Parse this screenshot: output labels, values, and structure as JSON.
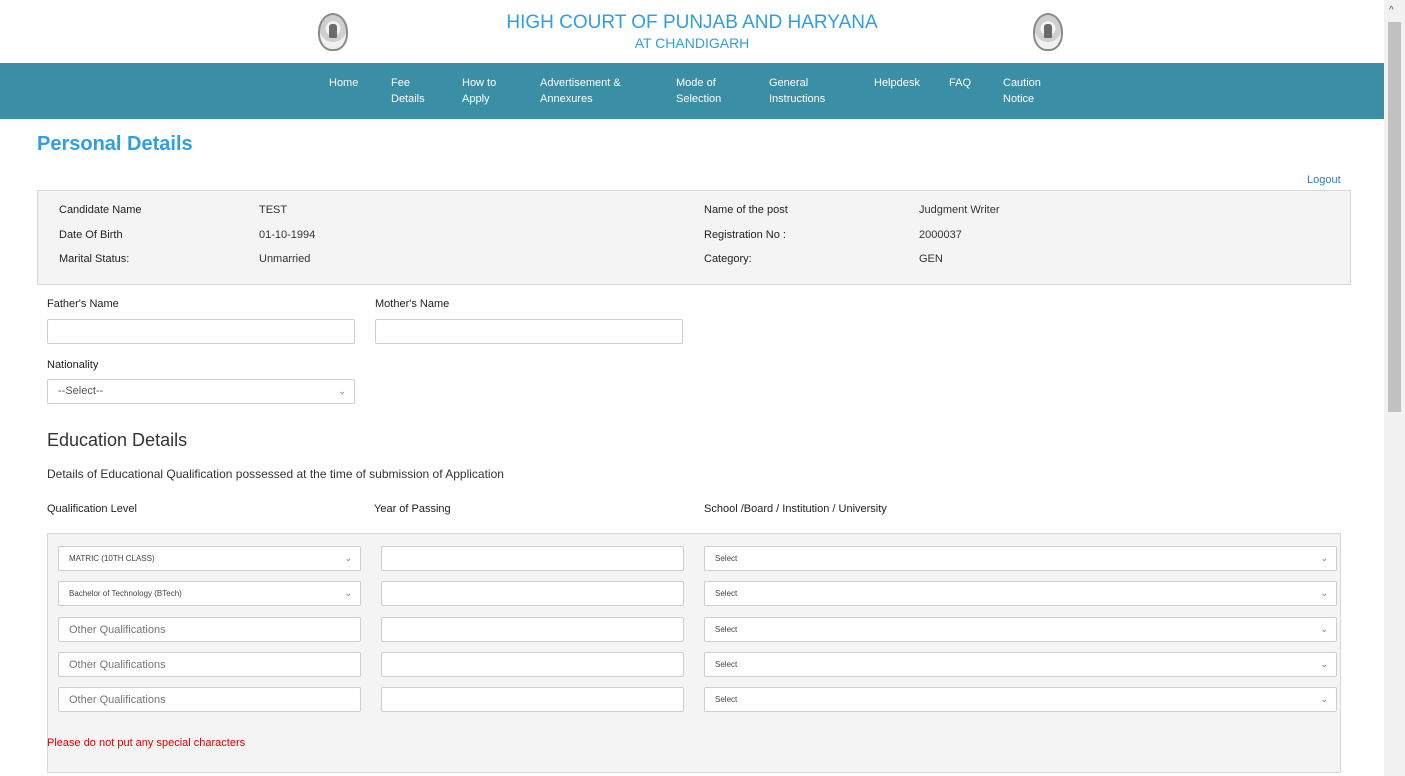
{
  "header": {
    "title": "HIGH COURT OF PUNJAB AND HARYANA",
    "subtitle": "AT CHANDIGARH"
  },
  "nav": [
    "Home",
    "Fee\nDetails",
    "How to\nApply",
    "Advertisement &\nAnnexures",
    "Mode of\nSelection",
    "General\nInstructions",
    "Helpdesk",
    "FAQ",
    "Caution\nNotice"
  ],
  "page": {
    "title": "Personal Details",
    "logout": "Logout"
  },
  "candidate": {
    "name_label": "Candidate Name",
    "name": "TEST",
    "dob_label": "Date Of Birth",
    "dob": "01-10-1994",
    "marital_label": "Marital Status:",
    "marital": "Unmarried",
    "post_label": "Name of the post",
    "post": "Judgment Writer",
    "reg_label": "Registration No :",
    "reg": "2000037",
    "category_label": "Category:",
    "category": "GEN"
  },
  "form": {
    "father_label": "Father's Name",
    "father_value": "",
    "mother_label": "Mother's Name",
    "mother_value": "",
    "nationality_label": "Nationality",
    "nationality_value": "--Select--"
  },
  "education": {
    "title": "Education Details",
    "description": "Details of Educational Qualification possessed at the time of submission of Application",
    "col_level": "Qualification Level",
    "col_year": "Year of Passing",
    "col_school": "School /Board / Institution / University",
    "rows": [
      {
        "level": "MATRIC (10TH CLASS)",
        "level_type": "select",
        "year": "",
        "school": "Select"
      },
      {
        "level": "Bachelor of Technology (BTech)",
        "level_type": "select",
        "year": "",
        "school": "Select"
      },
      {
        "level": "Other Qualifications",
        "level_type": "input",
        "year": "",
        "school": "Select"
      },
      {
        "level": "Other Qualifications",
        "level_type": "input",
        "year": "",
        "school": "Select"
      },
      {
        "level": "Other Qualifications",
        "level_type": "input",
        "year": "",
        "school": "Select"
      }
    ],
    "warning": "Please do not put any special characters"
  }
}
